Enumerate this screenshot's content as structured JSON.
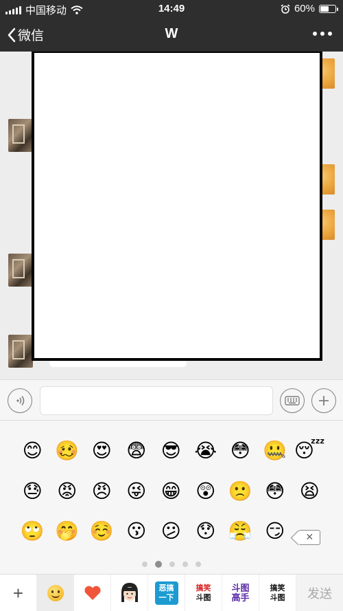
{
  "status_bar": {
    "carrier": "中国移动",
    "time": "14:49",
    "battery": "60%",
    "battery_level": 0.6,
    "alarm_icon": "alarm-clock-icon",
    "wifi_icon": "wifi-icon"
  },
  "nav": {
    "back_label": "微信",
    "title": "W",
    "more_icon": "more-dots-icon"
  },
  "input": {
    "voice_icon": "voice-icon",
    "keyboard_icon": "keyboard-icon",
    "plus_icon": "plus-icon",
    "placeholder": ""
  },
  "emoji_panel": {
    "rows": [
      [
        "😊",
        "🥴",
        "😍",
        "😨",
        "😎",
        "😭",
        "😳",
        "🤐",
        "😴"
      ],
      [
        "😓",
        "😡",
        "😠",
        "😜",
        "😁",
        "😲",
        "🙁",
        "😳",
        "😫"
      ],
      [
        "🙄",
        "🤭",
        "☺️",
        "😗",
        "😕",
        "😯",
        "😤",
        "😏"
      ]
    ],
    "delete_icon": "backspace-icon",
    "page_count": 5,
    "active_page": 2
  },
  "tab_bar": {
    "plus": "+",
    "tabs": [
      {
        "name": "emoji-tab",
        "icon": "smiley-icon"
      },
      {
        "name": "favorites-tab",
        "icon": "heart-icon"
      },
      {
        "name": "sticker-girl-tab",
        "icon": "girl-sticker-icon"
      },
      {
        "name": "sticker-pack-1",
        "line1": "恶搞",
        "line2": "一下"
      },
      {
        "name": "sticker-pack-2",
        "line1": "搞笑",
        "line2": "斗图"
      },
      {
        "name": "sticker-pack-3",
        "line1": "斗图",
        "line2": "高手"
      },
      {
        "name": "sticker-pack-4",
        "line1": "搞笑",
        "line2": "斗图"
      }
    ],
    "send_label": "发送"
  },
  "colors": {
    "nav_bg": "#2e2e2e",
    "chat_bg": "#ededed",
    "panel_bg": "#f6f6f6",
    "send_text": "#a9a9a9"
  }
}
